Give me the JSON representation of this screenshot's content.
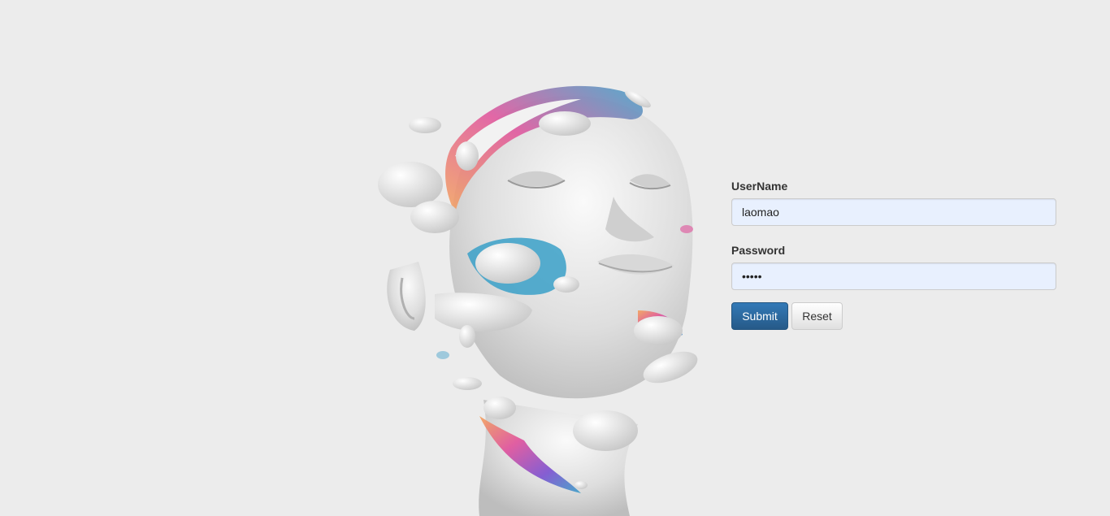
{
  "login": {
    "username_label": "UserName",
    "username_value": "laomao",
    "password_label": "Password",
    "password_value": "laoma",
    "submit_label": "Submit",
    "reset_label": "Reset"
  },
  "colors": {
    "background": "#ececec",
    "input_fill": "#e8f0fe",
    "primary_button": "#2a6496",
    "accent_blue": "#3aa0c8",
    "accent_pink": "#e0509a",
    "accent_orange": "#f4a25a"
  }
}
